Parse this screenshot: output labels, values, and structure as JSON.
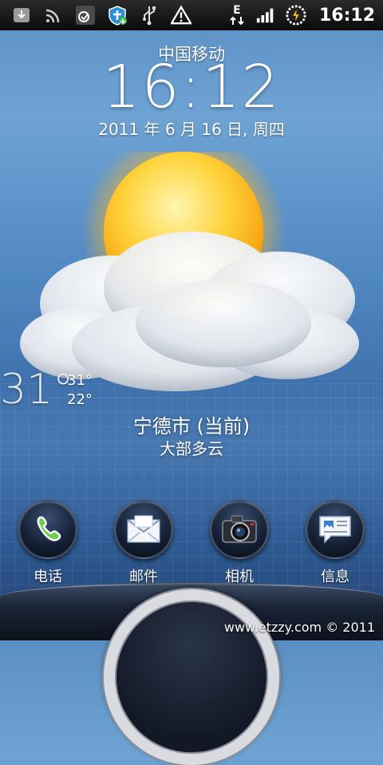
{
  "status_bar": {
    "network_type": "E",
    "time": "16:12",
    "icons": [
      "download-icon",
      "wifi-icon",
      "evernote-icon",
      "security-shield-icon",
      "usb-icon",
      "warning-icon",
      "data-arrows-icon",
      "signal-icon",
      "battery-charging-icon"
    ]
  },
  "lockscreen": {
    "carrier": "中国移动",
    "clock": "16:12",
    "date": "2011 年 6 月 16 日, 周四"
  },
  "weather": {
    "current_temp": "31°",
    "high": "31°",
    "low": "22°",
    "city": "宁德市 (当前)",
    "condition": "大部多云",
    "icon": "sun-behind-cloud"
  },
  "dock": {
    "items": [
      {
        "label": "电话",
        "icon": "phone-icon"
      },
      {
        "label": "邮件",
        "icon": "mail-icon"
      },
      {
        "label": "相机",
        "icon": "camera-icon"
      },
      {
        "label": "信息",
        "icon": "message-icon"
      }
    ]
  },
  "watermark": "www.etzzy.com © 2011"
}
